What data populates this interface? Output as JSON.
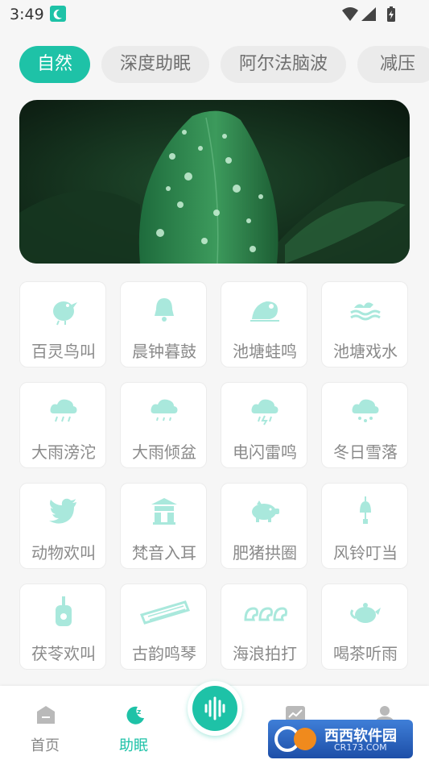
{
  "status_bar": {
    "time": "3:49"
  },
  "tabs": [
    {
      "label": "自然",
      "active": true
    },
    {
      "label": "深度助眠",
      "active": false
    },
    {
      "label": "阿尔法脑波",
      "active": false
    },
    {
      "label": "减压",
      "active": false
    }
  ],
  "sounds": [
    {
      "label": "百灵鸟叫",
      "icon": "bird-icon"
    },
    {
      "label": "晨钟暮鼓",
      "icon": "bell-icon"
    },
    {
      "label": "池塘蛙鸣",
      "icon": "frog-icon"
    },
    {
      "label": "池塘戏水",
      "icon": "water-waves-icon"
    },
    {
      "label": "大雨滂沱",
      "icon": "heavy-rain-icon"
    },
    {
      "label": "大雨倾盆",
      "icon": "rain-cloud-icon"
    },
    {
      "label": "电闪雷鸣",
      "icon": "thunder-cloud-icon"
    },
    {
      "label": "冬日雪落",
      "icon": "snow-cloud-icon"
    },
    {
      "label": "动物欢叫",
      "icon": "twitter-bird-icon"
    },
    {
      "label": "梵音入耳",
      "icon": "temple-icon"
    },
    {
      "label": "肥猪拱圈",
      "icon": "pig-icon"
    },
    {
      "label": "风铃叮当",
      "icon": "wind-chime-icon"
    },
    {
      "label": "茯苓欢叫",
      "icon": "ukulele-icon"
    },
    {
      "label": "古韵鸣琴",
      "icon": "guqin-icon"
    },
    {
      "label": "海浪拍打",
      "icon": "sea-waves-icon"
    },
    {
      "label": "喝茶听雨",
      "icon": "teapot-icon"
    }
  ],
  "nav": {
    "home": "首页",
    "sleep": "助眠"
  },
  "watermark": {
    "line1": "西西软件园",
    "line2": "CR173.COM"
  },
  "colors": {
    "accent": "#1ec2a7",
    "icon": "#a9e8dc"
  }
}
